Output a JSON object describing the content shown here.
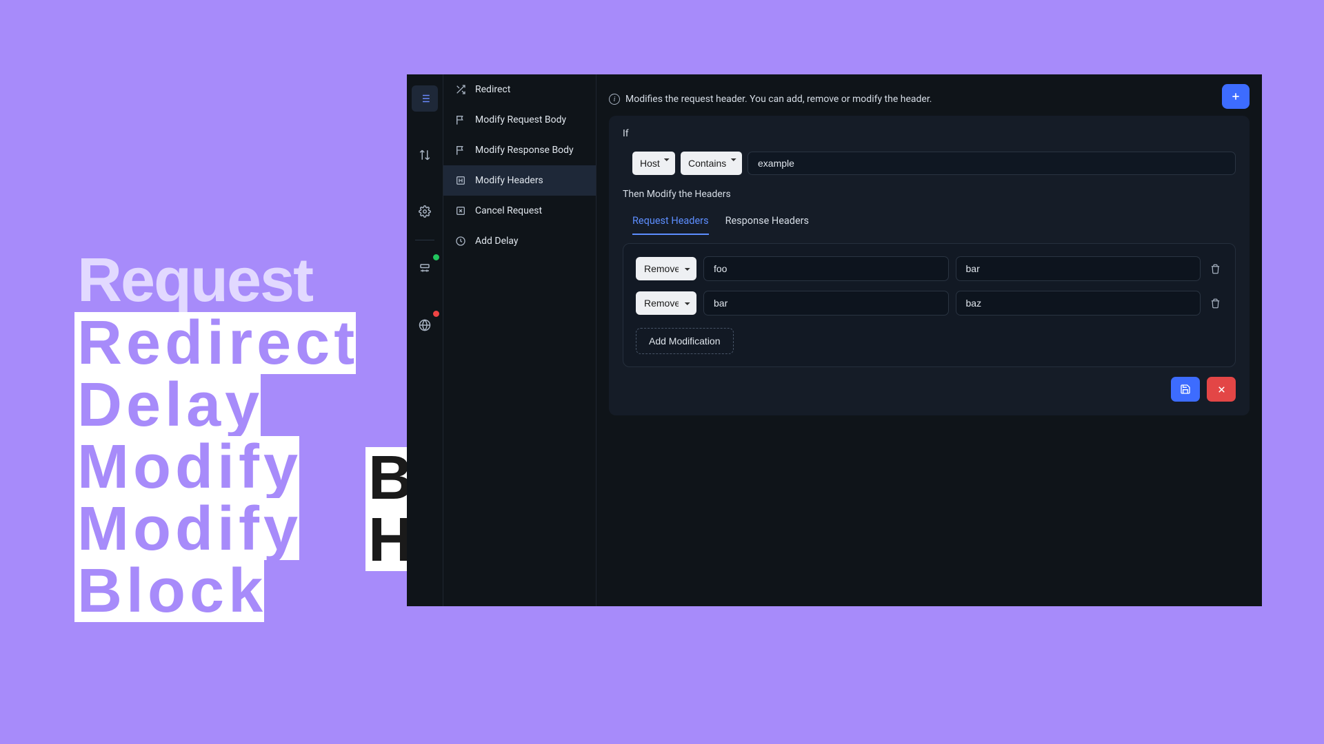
{
  "decor": {
    "heading": "Request",
    "lines": [
      {
        "word": "Redirect",
        "dark": false
      },
      {
        "word": "Delay",
        "dark": false
      },
      {
        "word": "Modify",
        "dark": false
      },
      {
        "word": "Modify",
        "dark": false
      },
      {
        "word": "Block",
        "dark": false
      }
    ],
    "lines2": [
      {
        "word": "Body",
        "dark": true
      },
      {
        "word": "Headers",
        "dark": true
      }
    ]
  },
  "rules": [
    {
      "label": "Redirect",
      "icon": "shuffle",
      "selected": false
    },
    {
      "label": "Modify Request Body",
      "icon": "flag",
      "selected": false
    },
    {
      "label": "Modify Response Body",
      "icon": "flag",
      "selected": false
    },
    {
      "label": "Modify Headers",
      "icon": "header",
      "selected": true
    },
    {
      "label": "Cancel Request",
      "icon": "cancel",
      "selected": false
    },
    {
      "label": "Add Delay",
      "icon": "clock",
      "selected": false
    }
  ],
  "description": "Modifies the request header. You can add, remove or modify the header.",
  "condition": {
    "label": "If",
    "type": "Host",
    "operator": "Contains",
    "value": "example"
  },
  "then_label": "Then Modify the Headers",
  "tabs": [
    {
      "label": "Request Headers",
      "active": true
    },
    {
      "label": "Response Headers",
      "active": false
    }
  ],
  "modifications": [
    {
      "action": "Remove",
      "key": "foo",
      "value": "bar"
    },
    {
      "action": "Remove",
      "key": "bar",
      "value": "baz"
    }
  ],
  "add_modification_label": "Add Modification",
  "rail_badges": {
    "proxy": "green",
    "globe": "red"
  }
}
